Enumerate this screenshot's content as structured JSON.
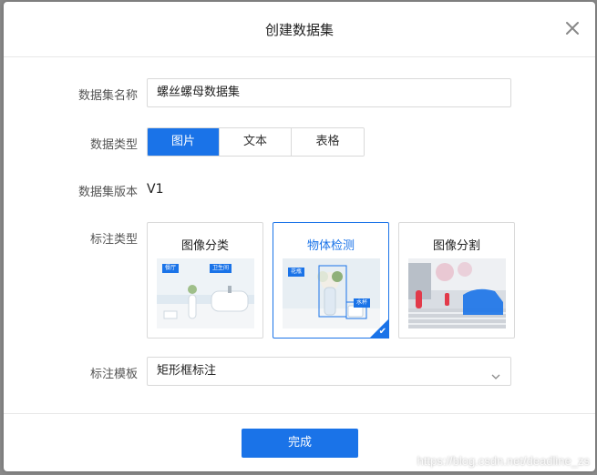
{
  "dialog": {
    "title": "创建数据集",
    "close_icon": "close-icon"
  },
  "form": {
    "name": {
      "label": "数据集名称",
      "value": "螺丝螺母数据集"
    },
    "type": {
      "label": "数据类型",
      "options": [
        "图片",
        "文本",
        "表格"
      ],
      "selected": "图片"
    },
    "version": {
      "label": "数据集版本",
      "value": "V1"
    },
    "annotation": {
      "label": "标注类型",
      "cards": [
        {
          "title": "图像分类",
          "tags": [
            "餐厅",
            "卫生间"
          ],
          "selected": false
        },
        {
          "title": "物体检测",
          "tags": [
            "花瓶",
            "水杯"
          ],
          "selected": true
        },
        {
          "title": "图像分割",
          "tags": [],
          "selected": false
        }
      ]
    },
    "template": {
      "label": "标注模板",
      "value": "矩形框标注"
    }
  },
  "footer": {
    "submit_label": "完成"
  },
  "watermark": "https://blog.csdn.net/deadline_zs",
  "colors": {
    "accent": "#1a73e8",
    "border": "#d9d9d9"
  }
}
